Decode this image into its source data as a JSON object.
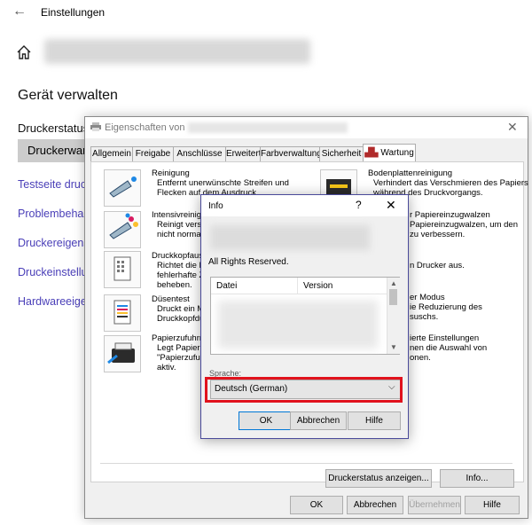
{
  "settings": {
    "title": "Einstellungen",
    "heading": "Gerät verwalten",
    "status_label": "Druckerstatus",
    "status_button": "Druckerwart",
    "links": [
      "Testseite druc",
      "Problembehar",
      "Druckereigens",
      "Druckeinstellu",
      "Hardwareeige"
    ]
  },
  "props": {
    "title": "Eigenschaften von",
    "tabs": [
      "Allgemein",
      "Freigabe",
      "Anschlüsse",
      "Erweitert",
      "Farbverwaltung",
      "Sicherheit",
      "Wartung"
    ],
    "active_tab": "Wartung",
    "left_items": [
      {
        "title": "Reinigung",
        "desc": "Entfernt unerwünschte Streifen und\nFlecken auf dem Ausdruck."
      },
      {
        "title": "Intensivreinigu",
        "desc": "Reinigt verst\nnicht normal"
      },
      {
        "title": "Druckkopfausr",
        "desc": "Richtet die D\nfehlerhafte Z\nbeheben."
      },
      {
        "title": "Düsentest",
        "desc": "Druckt ein M\nDruckkopfdü"
      },
      {
        "title": "Papierzufuhrrei",
        "desc": "Legt Papierz\n\"Papierzufuh\naktiv."
      }
    ],
    "right_items": [
      {
        "title": "Bodenplattenreinigung",
        "desc": "Verhindert das Verschmieren des Papiers\nwährend des Druckvorgangs."
      },
      {
        "title": "",
        "desc": "r Papiereinzugwalzen\nPapiereinzugwalzen, um den\nzu verbessern."
      },
      {
        "title": "",
        "desc": "n Drucker aus."
      },
      {
        "title": "",
        "desc": "er Modus\nie Reduzierung des\nsuschs."
      },
      {
        "title": "",
        "desc": "ierte Einstellungen\nnen die Auswahl von\nonen."
      }
    ],
    "status_button": "Druckerstatus anzeigen...",
    "info_button": "Info...",
    "ok": "OK",
    "cancel": "Abbrechen",
    "apply": "Übernehmen",
    "help": "Hilfe"
  },
  "info": {
    "title": "Info",
    "help_glyph": "?",
    "rights": "All Rights Reserved.",
    "col_file": "Datei",
    "col_version": "Version",
    "lang_label": "Sprache:",
    "lang_value": "Deutsch (German)",
    "ok": "OK",
    "cancel": "Abbrechen",
    "help": "Hilfe"
  }
}
